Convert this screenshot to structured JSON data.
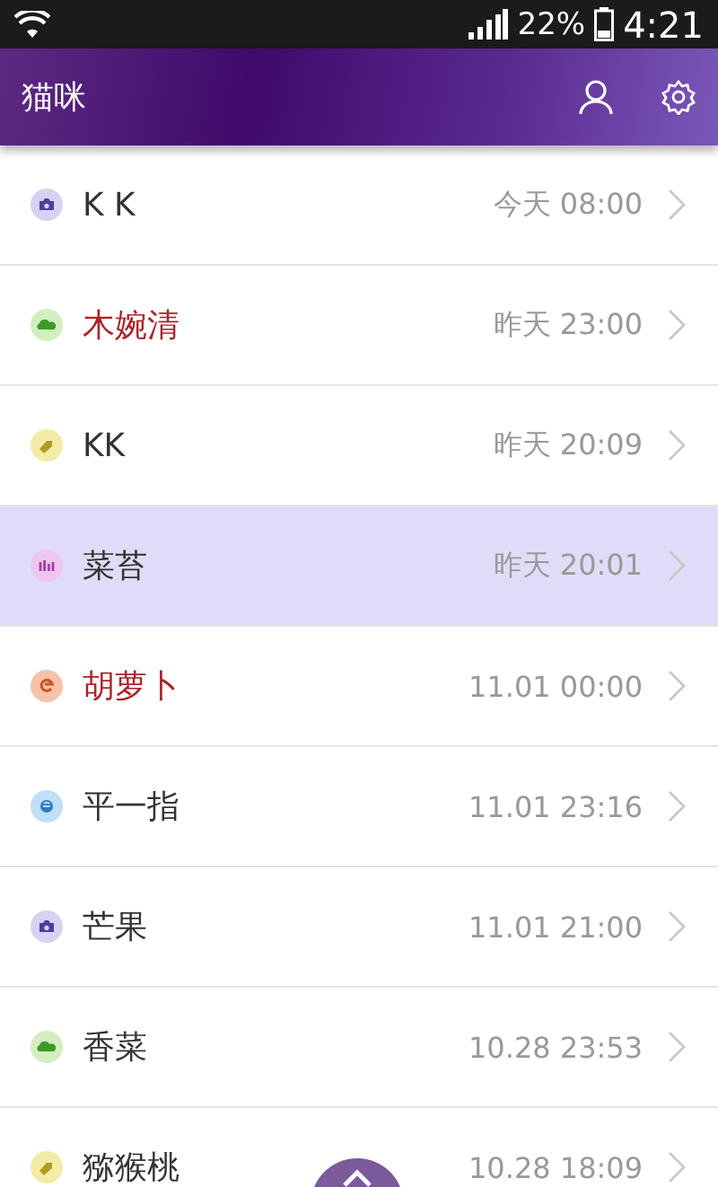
{
  "status_bar": {
    "battery": "22%",
    "time": "4:21"
  },
  "header": {
    "title": "猫咪"
  },
  "items": [
    {
      "kind": "camera",
      "name": "K K",
      "time": "今天 08:00",
      "marked": false,
      "selected": false
    },
    {
      "kind": "cloud",
      "name": "木婉清",
      "time": "昨天 23:00",
      "marked": true,
      "selected": false
    },
    {
      "kind": "tag",
      "name": "KK",
      "time": "昨天 20:09",
      "marked": false,
      "selected": false
    },
    {
      "kind": "chart",
      "name": "菜苔",
      "time": "昨天 20:01",
      "marked": false,
      "selected": true
    },
    {
      "kind": "swirl",
      "name": "胡萝卜",
      "time": "11.01 00:00",
      "marked": true,
      "selected": false
    },
    {
      "kind": "globe",
      "name": "平一指",
      "time": "11.01 23:16",
      "marked": false,
      "selected": false
    },
    {
      "kind": "camera",
      "name": "芒果",
      "time": "11.01 21:00",
      "marked": false,
      "selected": false
    },
    {
      "kind": "cloud",
      "name": "香菜",
      "time": "10.28 23:53",
      "marked": false,
      "selected": false
    },
    {
      "kind": "tag",
      "name": "猕猴桃",
      "time": "10.28 18:09",
      "marked": false,
      "selected": false
    }
  ]
}
